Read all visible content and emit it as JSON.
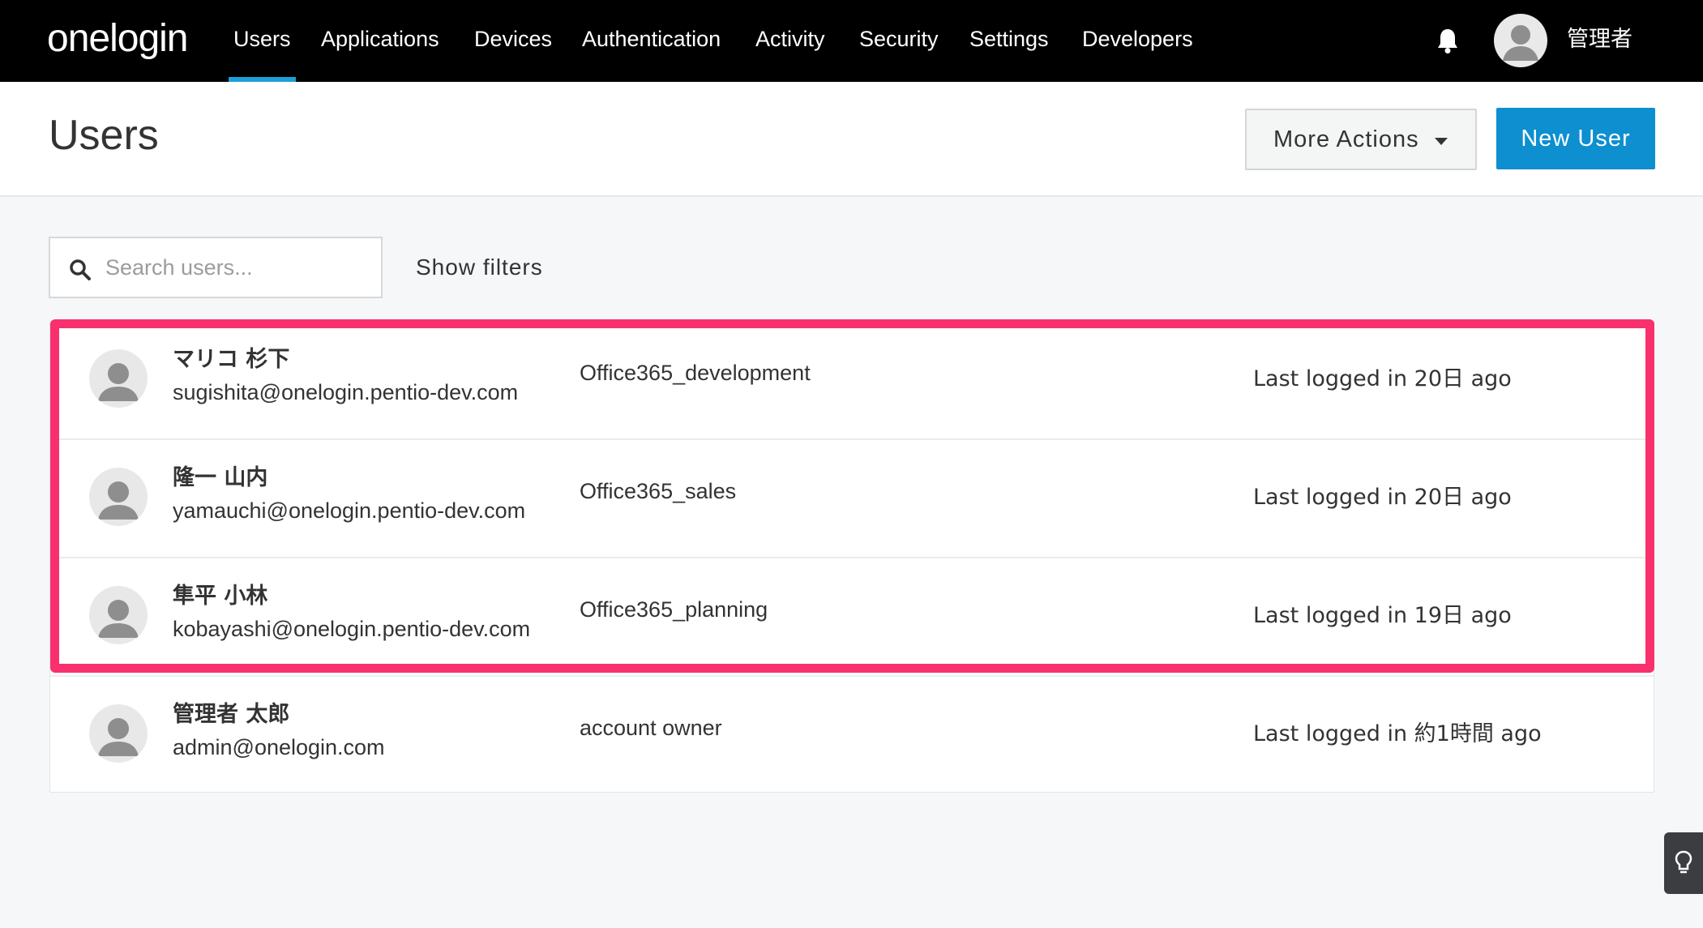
{
  "brand": {
    "logo_text": "onelogin"
  },
  "nav": {
    "items": [
      {
        "label": "Users",
        "active": true
      },
      {
        "label": "Applications"
      },
      {
        "label": "Devices"
      },
      {
        "label": "Authentication"
      },
      {
        "label": "Activity"
      },
      {
        "label": "Security"
      },
      {
        "label": "Settings"
      },
      {
        "label": "Developers"
      }
    ],
    "notifications_icon": "bell-icon",
    "account_name": "管理者"
  },
  "header": {
    "title": "Users",
    "more_actions_label": "More Actions",
    "new_user_label": "New User"
  },
  "search": {
    "placeholder": "Search users...",
    "value": "",
    "show_filters_label": "Show filters"
  },
  "users": [
    {
      "name": "マリコ 杉下",
      "email": "sugishita@onelogin.pentio-dev.com",
      "role": "Office365_development",
      "last_login": "Last logged in 20日 ago"
    },
    {
      "name": "隆一 山内",
      "email": "yamauchi@onelogin.pentio-dev.com",
      "role": "Office365_sales",
      "last_login": "Last logged in 20日 ago"
    },
    {
      "name": "隼平 小林",
      "email": "kobayashi@onelogin.pentio-dev.com",
      "role": "Office365_planning",
      "last_login": "Last logged in 19日 ago"
    },
    {
      "name": "管理者 太郎",
      "email": "admin@onelogin.com",
      "role": "account owner",
      "last_login": "Last logged in 約1時間 ago"
    }
  ],
  "colors": {
    "nav_background": "#000000",
    "nav_active_underline": "#1ca0d8",
    "primary_button": "#0d8fd0",
    "highlight_border": "#f8316e"
  }
}
